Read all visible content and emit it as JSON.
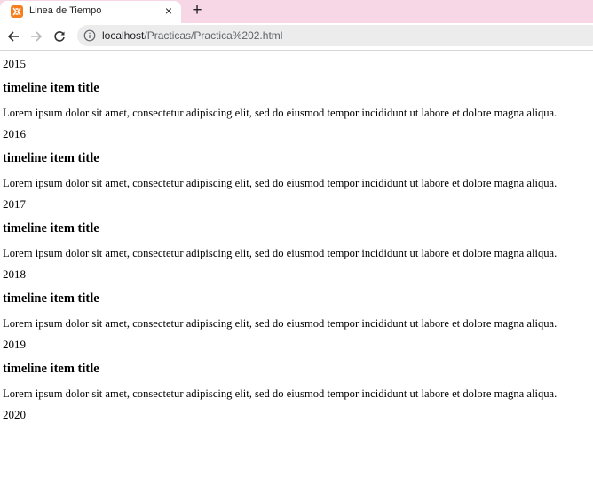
{
  "browser": {
    "tab_title": "Linea de Tiempo",
    "tab_close": "×",
    "new_tab": "+",
    "url_host": "localhost",
    "url_path": "/Practicas/Practica%202.html"
  },
  "timeline": {
    "items": [
      {
        "year": "2015",
        "title": "timeline item title",
        "text": "Lorem ipsum dolor sit amet, consectetur adipiscing elit, sed do eiusmod tempor incididunt ut labore et dolore magna aliqua."
      },
      {
        "year": "2016",
        "title": "timeline item title",
        "text": "Lorem ipsum dolor sit amet, consectetur adipiscing elit, sed do eiusmod tempor incididunt ut labore et dolore magna aliqua."
      },
      {
        "year": "2017",
        "title": "timeline item title",
        "text": "Lorem ipsum dolor sit amet, consectetur adipiscing elit, sed do eiusmod tempor incididunt ut labore et dolore magna aliqua."
      },
      {
        "year": "2018",
        "title": "timeline item title",
        "text": "Lorem ipsum dolor sit amet, consectetur adipiscing elit, sed do eiusmod tempor incididunt ut labore et dolore magna aliqua."
      },
      {
        "year": "2019",
        "title": "timeline item title",
        "text": "Lorem ipsum dolor sit amet, consectetur adipiscing elit, sed do eiusmod tempor incididunt ut labore et dolore magna aliqua."
      }
    ],
    "last_year": "2020"
  }
}
